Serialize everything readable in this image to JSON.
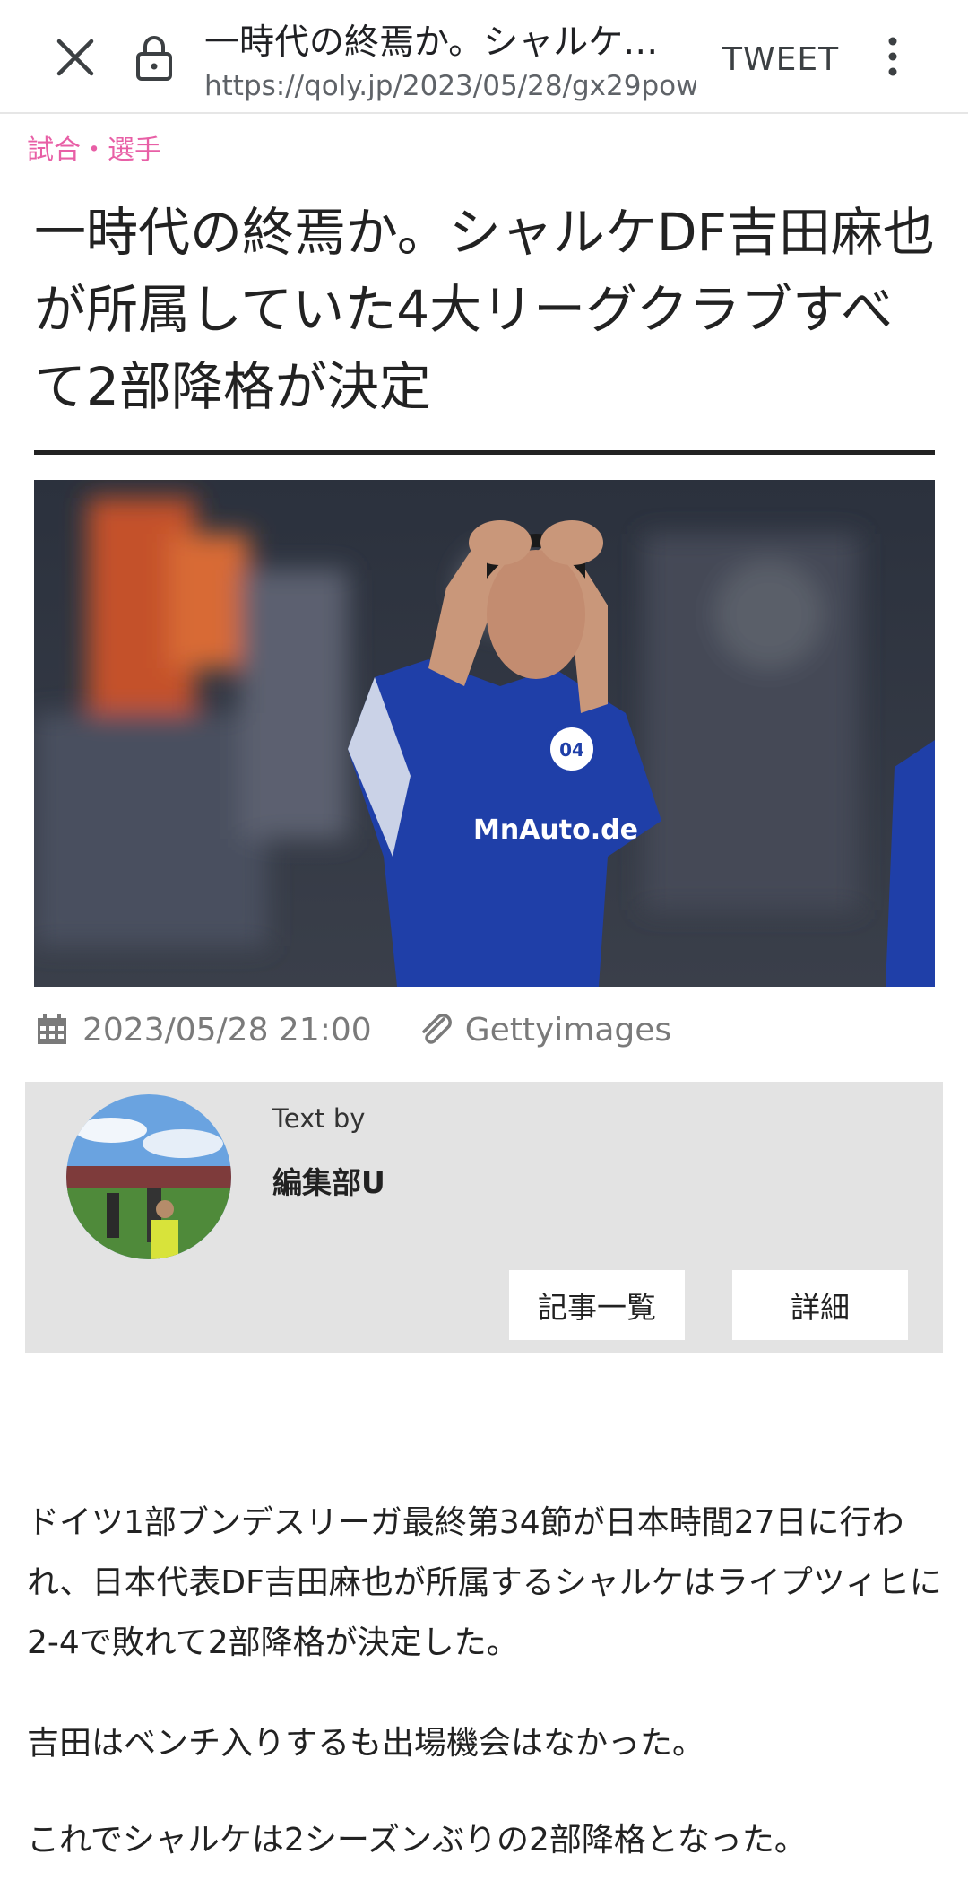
{
  "browser": {
    "page_title": "一時代の終焉か。シャルケ…",
    "url": "https://qoly.jp/2023/05/28/gx29pow",
    "tweet_label": "TWEET",
    "close_icon": "close-icon",
    "lock_icon": "lock-icon",
    "more_icon": "more-vert-icon"
  },
  "article": {
    "category": "試合・選手",
    "headline": "一時代の終焉か。シャルケDF吉田麻也が所属していた4大リーグクラブすべて2部降格が決定",
    "date": "2023/05/28 21:00",
    "credit": "Gettyimages",
    "paragraphs": [
      "ドイツ1部ブンデスリーガ最終第34節が日本時間27日に行われ、日本代表DF吉田麻也が所属するシャルケはライプツィヒに2-4で敗れて2部降格が決定した。",
      "吉田はベンチ入りするも出場機会はなかった。",
      "これでシャルケは2シーズンぶりの2部降格となった。"
    ]
  },
  "author": {
    "text_by": "Text by",
    "name": "編集部U",
    "list_button": "記事一覧",
    "detail_button": "詳細"
  },
  "colors": {
    "category": "#e85fa6",
    "jersey": "#1f3fa8",
    "author_box": "#e3e3e3"
  }
}
